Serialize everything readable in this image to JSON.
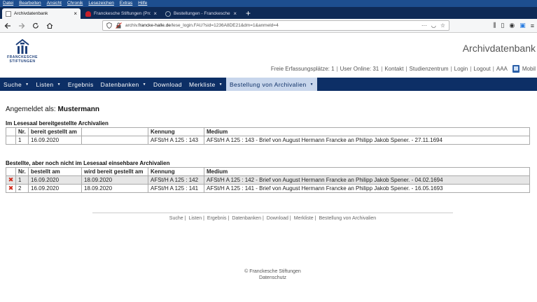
{
  "browser": {
    "menu": [
      "Datei",
      "Bearbeiten",
      "Ansicht",
      "Chronik",
      "Lesezeichen",
      "Extras",
      "Hilfe"
    ],
    "tabs": [
      {
        "label": "Archivdatenbank",
        "active": true
      },
      {
        "label": "Franckesche Stiftungen (Producti",
        "active": false
      },
      {
        "label": "Bestellungen - Franckesche Stiftu",
        "active": false
      }
    ],
    "new_tab": "+",
    "url_prefix": "archiv.",
    "url_domain": "francke-halle.de",
    "url_rest": "/lese_login.FAU?sid=1236A8DE21&dm=1&anmeld=4",
    "url_dots": "···"
  },
  "header": {
    "logo_line1": "FRANCKESCHE",
    "logo_line2": "STIFTUNGEN",
    "title": "Archivdatenbank",
    "free_slots_label": "Freie Erfassungsplätze: 1",
    "users_online_label": "User Online: 31",
    "links": [
      "Kontakt",
      "Studienzentrum",
      "Login",
      "Logout",
      "AAA"
    ],
    "mobil_label": "Mobil"
  },
  "nav": [
    {
      "label": "Suche",
      "caret": true
    },
    {
      "label": "Listen",
      "caret": true
    },
    {
      "label": "Ergebnis",
      "caret": false
    },
    {
      "label": "Datenbanken",
      "caret": true
    },
    {
      "label": "Download",
      "caret": false
    },
    {
      "label": "Merkliste",
      "caret": true
    },
    {
      "label": "Bestellung von Archivalien",
      "caret": true,
      "selected": true
    }
  ],
  "content": {
    "logged_in_label": "Angemeldet als:",
    "username": "Mustermann",
    "ready": {
      "title": "Im Lesesaal bereitgestellte Archivalien",
      "headers": [
        "Nr.",
        "bereit gestellt am",
        "",
        "Kennung",
        "Medium"
      ],
      "rows": [
        [
          "1",
          "16.09.2020",
          "",
          "AFSt/H A 125 : 143",
          "AFSt/H A 125 : 143 - Brief von August Hermann Francke an Philipp Jakob Spener. - 27.11.1694"
        ]
      ]
    },
    "ordered": {
      "title": "Bestellte, aber noch nicht im Lesesaal einsehbare Archivalien",
      "headers": [
        "Nr.",
        "bestellt am",
        "wird bereit gestellt am",
        "Kennung",
        "Medium"
      ],
      "rows": [
        [
          "1",
          "16.09.2020",
          "18.09.2020",
          "AFSt/H A 125 : 142",
          "AFSt/H A 125 : 142 - Brief von August Hermann Francke an Philipp Jakob Spener. - 04.02.1694"
        ],
        [
          "2",
          "16.09.2020",
          "18.09.2020",
          "AFSt/H A 125 : 141",
          "AFSt/H A 125 : 141 - Brief von August Hermann Francke an Philipp Jakob Spener. - 16.05.1693"
        ]
      ]
    }
  },
  "footer": {
    "links": [
      "Suche",
      "Listen",
      "Ergebnis",
      "Datenbanken",
      "Download",
      "Merkliste",
      "Bestellung von Archivalien"
    ],
    "copyright": "© Franckesche Stiftungen",
    "privacy": "Datenschutz"
  }
}
